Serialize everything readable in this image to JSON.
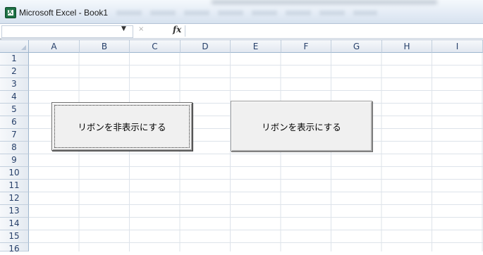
{
  "window": {
    "title": "Microsoft Excel - Book1",
    "app_icon": "excel-icon"
  },
  "formula_bar": {
    "name_box_value": "",
    "fx_label": "fx",
    "cancel_symbol": "×",
    "formula_value": ""
  },
  "columns": [
    "A",
    "B",
    "C",
    "D",
    "E",
    "F",
    "G",
    "H",
    "I"
  ],
  "rows": [
    "1",
    "2",
    "3",
    "4",
    "5",
    "6",
    "7",
    "8",
    "9",
    "10",
    "11",
    "12",
    "13",
    "14",
    "15",
    "16"
  ],
  "buttons": {
    "hide_ribbon": "リボンを非表示にする",
    "show_ribbon": "リボンを表示にする"
  },
  "colors": {
    "grid_line": "#dde3ea",
    "header_text": "#27406a",
    "button_face": "#f0f0f0"
  }
}
